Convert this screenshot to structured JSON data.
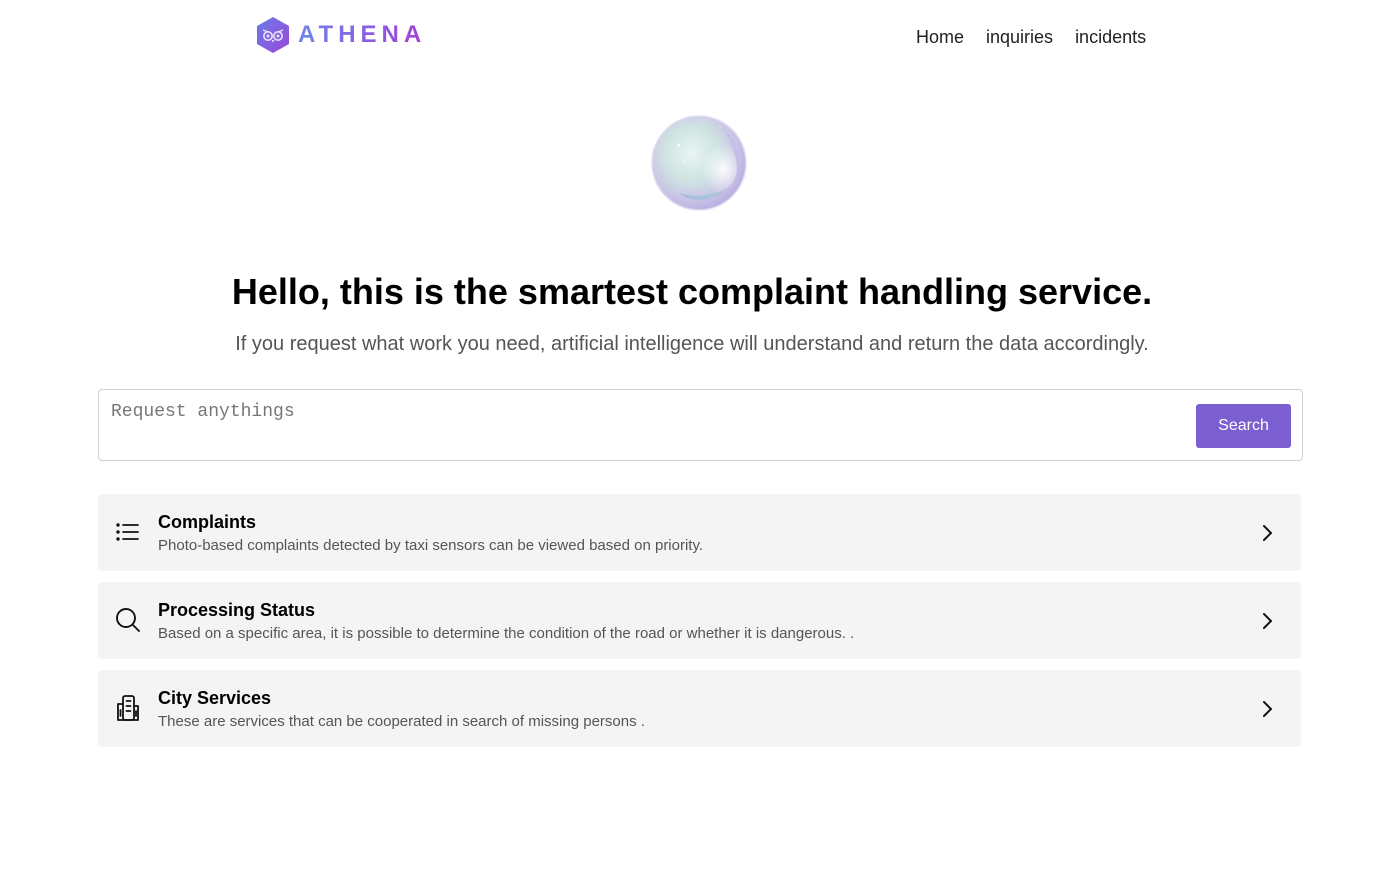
{
  "brand": {
    "name": "ATHENA"
  },
  "nav": {
    "items": [
      {
        "label": "Home"
      },
      {
        "label": "inquiries"
      },
      {
        "label": "incidents"
      }
    ]
  },
  "hero": {
    "title": "Hello, this is the smartest complaint handling service.",
    "subtitle": "If you request what work you need, artificial intelligence will understand and return the data accordingly."
  },
  "search": {
    "placeholder": "Request anythings",
    "value": "",
    "button_label": "Search"
  },
  "cards": [
    {
      "icon": "list-icon",
      "title": "Complaints",
      "description": "Photo-based complaints detected by taxi sensors can be viewed based on priority."
    },
    {
      "icon": "search-icon",
      "title": "Processing Status",
      "description": "Based on a specific area, it is possible to determine the condition of the road or whether it is dangerous. ."
    },
    {
      "icon": "building-icon",
      "title": "City Services",
      "description": "These are services that can be cooperated in search of missing persons ."
    }
  ],
  "colors": {
    "accent": "#7b5fd0",
    "card_bg": "#f4f4f4",
    "logo_start": "#6f86e8",
    "logo_end": "#a63fd6"
  }
}
